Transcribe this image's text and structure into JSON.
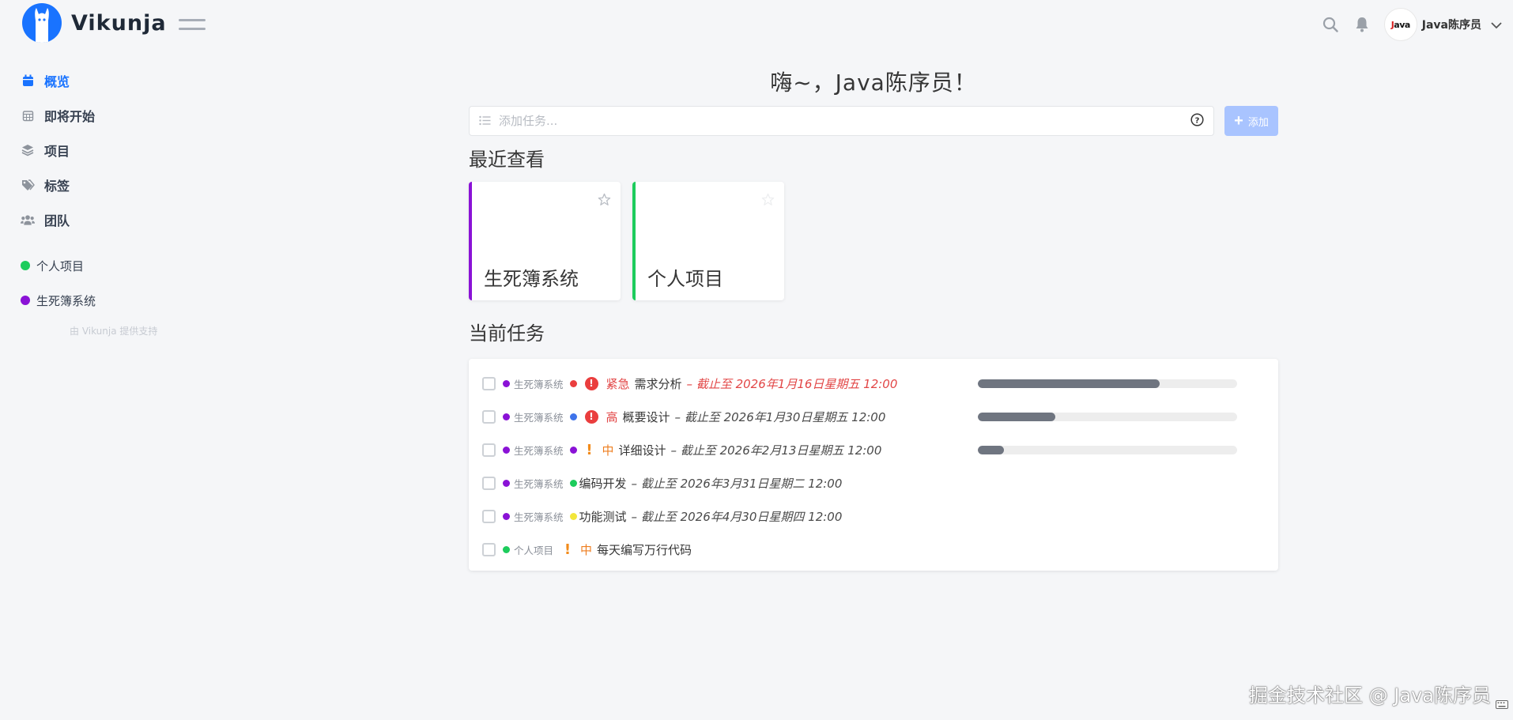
{
  "app": {
    "name": "Vikunja"
  },
  "header": {
    "search_icon": "search-icon",
    "notifications_icon": "bell-icon",
    "user": {
      "avatar_text_red": "J",
      "avatar_text": "ava",
      "name": "Java陈序员"
    }
  },
  "sidebar": {
    "nav": [
      {
        "label": "概览",
        "icon": "calendar-icon",
        "active": true
      },
      {
        "label": "即将开始",
        "icon": "calendar-grid-icon"
      },
      {
        "label": "项目",
        "icon": "layers-icon"
      },
      {
        "label": "标签",
        "icon": "tags-icon"
      },
      {
        "label": "团队",
        "icon": "users-icon"
      }
    ],
    "projects": [
      {
        "label": "个人项目",
        "color": "#1dcc5c"
      },
      {
        "label": "生死簿系统",
        "color": "#8a12d6"
      }
    ],
    "powered_by": "由 Vikunja 提供支持"
  },
  "main": {
    "greeting": "嗨~，Java陈序员！",
    "add_task": {
      "placeholder": "添加任务...",
      "button": "添加"
    },
    "recent_title": "最近查看",
    "recent": [
      {
        "name": "生死簿系统",
        "color": "#8a12d6"
      },
      {
        "name": "个人项目",
        "color": "#1dcc5c"
      }
    ],
    "current_title": "当前任务",
    "tasks": [
      {
        "project": "生死簿系统",
        "project_color": "#8a12d6",
        "task_color": "#ea3e3e",
        "priority": "紧急",
        "priority_style": "badge-red",
        "name": "需求分析",
        "due": "截止至 2026年1月16日星期五 12:00",
        "overdue": true,
        "progress": 0.7
      },
      {
        "project": "生死簿系统",
        "project_color": "#8a12d6",
        "task_color": "#3e73ea",
        "priority": "高",
        "priority_style": "badge-red",
        "name": "概要设计",
        "due": "截止至 2026年1月30日星期五 12:00",
        "overdue": false,
        "progress": 0.3
      },
      {
        "project": "生死簿系统",
        "project_color": "#8a12d6",
        "task_color": "#8a12d6",
        "priority": "中",
        "priority_style": "bang-orange",
        "name": "详细设计",
        "due": "截止至 2026年2月13日星期五 12:00",
        "overdue": false,
        "progress": 0.1
      },
      {
        "project": "生死簿系统",
        "project_color": "#8a12d6",
        "task_color": "#1dcc5c",
        "priority": "",
        "priority_style": "",
        "name": "编码开发",
        "due": "截止至 2026年3月31日星期二 12:00",
        "overdue": false
      },
      {
        "project": "生死簿系统",
        "project_color": "#8a12d6",
        "task_color": "#f2e63b",
        "priority": "",
        "priority_style": "",
        "name": "功能测试",
        "due": "截止至 2026年4月30日星期四 12:00",
        "overdue": false
      },
      {
        "project": "个人项目",
        "project_color": "#1dcc5c",
        "task_color": "",
        "priority": "中",
        "priority_style": "bang-orange",
        "name": "每天编写万行代码",
        "due": "",
        "overdue": false
      }
    ]
  },
  "watermark": "掘金技术社区 @ Java陈序员"
}
